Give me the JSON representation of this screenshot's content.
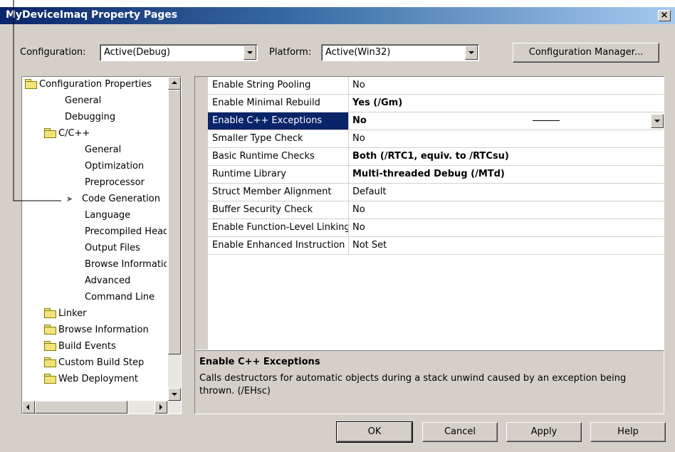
{
  "window": {
    "title": "MyDeviceImaq Property Pages",
    "close_glyph": "×"
  },
  "config_bar": {
    "configuration_label": "Configuration:",
    "configuration_value": "Active(Debug)",
    "platform_label": "Platform:",
    "platform_value": "Active(Win32)",
    "manager_button": "Configuration Manager..."
  },
  "tree": {
    "root": "Configuration Properties",
    "items": [
      {
        "label": "General"
      },
      {
        "label": "Debugging"
      },
      {
        "label": "C/C++"
      },
      {
        "label": "General"
      },
      {
        "label": "Optimization"
      },
      {
        "label": "Preprocessor"
      },
      {
        "label": "Code Generation"
      },
      {
        "label": "Language"
      },
      {
        "label": "Precompiled Headers"
      },
      {
        "label": "Output Files"
      },
      {
        "label": "Browse Information"
      },
      {
        "label": "Advanced"
      },
      {
        "label": "Command Line"
      },
      {
        "label": "Linker"
      },
      {
        "label": "Browse Information"
      },
      {
        "label": "Build Events"
      },
      {
        "label": "Custom Build Step"
      },
      {
        "label": "Web Deployment"
      }
    ],
    "selected_label": "Code Generation"
  },
  "properties": [
    {
      "name": "Enable String Pooling",
      "value": "No"
    },
    {
      "name": "Enable Minimal Rebuild",
      "value": "Yes (/Gm)"
    },
    {
      "name": "Enable C++ Exceptions",
      "value": "No"
    },
    {
      "name": "Smaller Type Check",
      "value": "No"
    },
    {
      "name": "Basic Runtime Checks",
      "value": "Both (/RTC1, equiv. to /RTCsu)"
    },
    {
      "name": "Runtime Library",
      "value": "Multi-threaded Debug (/MTd)"
    },
    {
      "name": "Struct Member Alignment",
      "value": "Default"
    },
    {
      "name": "Buffer Security Check",
      "value": "No"
    },
    {
      "name": "Enable Function-Level Linking",
      "value": "No"
    },
    {
      "name": "Enable Enhanced Instruction Set",
      "value": "Not Set"
    }
  ],
  "description": {
    "title": "Enable C++ Exceptions",
    "text": "Calls destructors for automatic objects during a stack unwind caused by an exception being thrown.     (/EHsc)"
  },
  "buttons": {
    "ok": "OK",
    "cancel": "Cancel",
    "apply": "Apply",
    "help": "Help"
  },
  "colors": {
    "dialog_bg": "#d4d0c8",
    "title_gradient_start": "#0a246a",
    "selection": "#0a246a"
  },
  "icons": [
    "folder-icon",
    "arrow-pointer-icon",
    "close-icon",
    "dropdown-arrow-icon"
  ]
}
